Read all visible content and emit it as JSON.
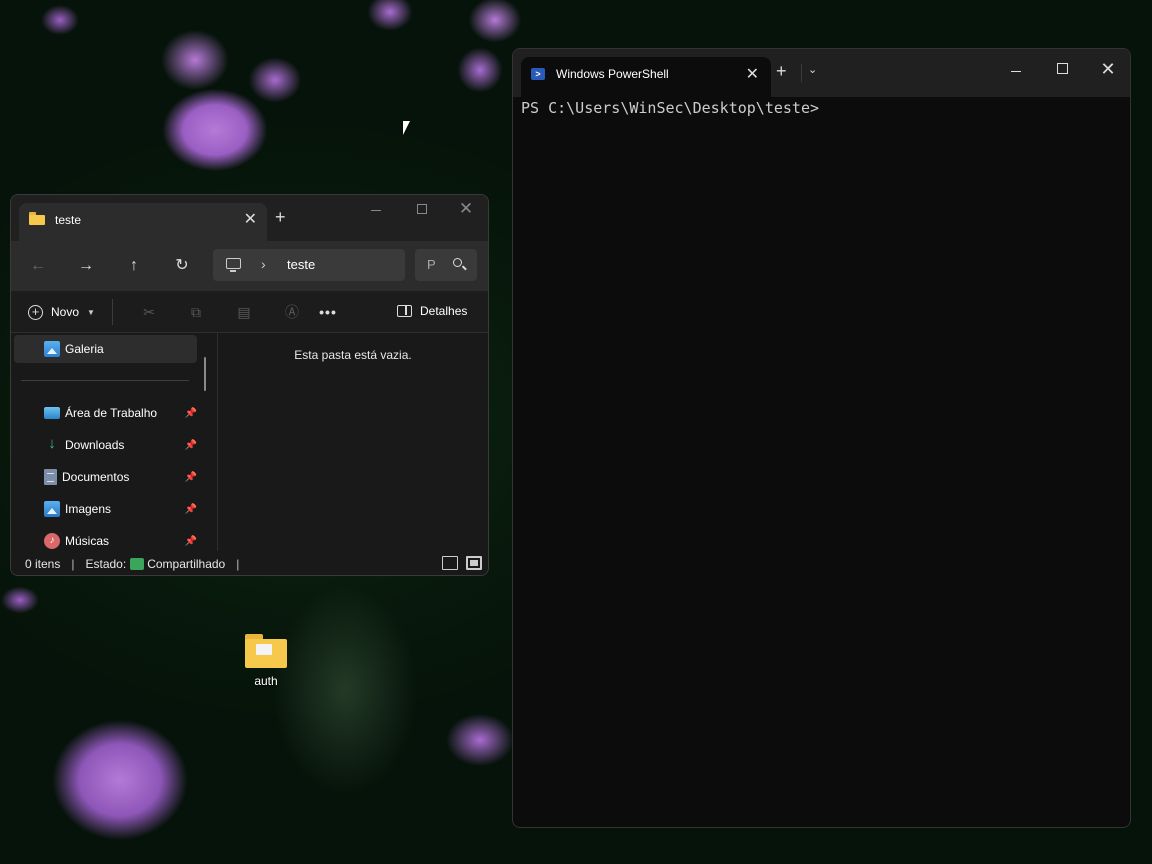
{
  "desktop": {
    "icons": [
      {
        "label": "auth"
      }
    ]
  },
  "explorer": {
    "tab_title": "teste",
    "address": {
      "path": "teste"
    },
    "search": {
      "placeholder": "P"
    },
    "toolbar": {
      "new_label": "Novo",
      "details_label": "Detalhes"
    },
    "sidebar": {
      "items": [
        {
          "label": "Galeria",
          "icon": "gallery-icon",
          "pinned": false,
          "selected": true
        },
        {
          "label": "Área de Trabalho",
          "icon": "desktop-icon",
          "pinned": true
        },
        {
          "label": "Downloads",
          "icon": "download-icon",
          "pinned": true
        },
        {
          "label": "Documentos",
          "icon": "document-icon",
          "pinned": true
        },
        {
          "label": "Imagens",
          "icon": "image-icon",
          "pinned": true
        },
        {
          "label": "Músicas",
          "icon": "music-icon",
          "pinned": true
        }
      ]
    },
    "content": {
      "empty_message": "Esta pasta está vazia."
    },
    "status": {
      "items_count": "0 itens",
      "state_label": "Estado:",
      "state_value": "Compartilhado"
    }
  },
  "terminal": {
    "tab_title": "Windows PowerShell",
    "prompt": "PS C:\\Users\\WinSec\\Desktop\\teste>"
  }
}
